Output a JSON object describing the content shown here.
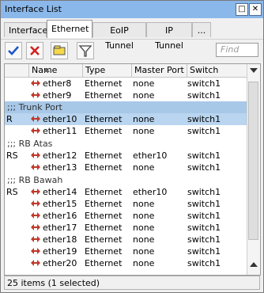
{
  "window": {
    "title": "Interface List",
    "restore_label": "□",
    "close_label": "✕"
  },
  "tabs": [
    {
      "label": "Interface"
    },
    {
      "label": "Ethernet"
    },
    {
      "label": "EoIP Tunnel"
    },
    {
      "label": "IP Tunnel"
    },
    {
      "label": "..."
    }
  ],
  "active_tab": "Ethernet",
  "toolbar": {
    "find_placeholder": "Find"
  },
  "table": {
    "columns": [
      "Name",
      "Type",
      "Master Port",
      "Switch"
    ],
    "rows": [
      {
        "flag": "",
        "name": "ether8",
        "type": "Ethernet",
        "master": "none",
        "switch": "switch1"
      },
      {
        "flag": "",
        "name": "ether9",
        "type": "Ethernet",
        "master": "none",
        "switch": "switch1"
      },
      {
        "group": ";;; Trunk Port"
      },
      {
        "flag": "R",
        "name": "ether10",
        "type": "Ethernet",
        "master": "none",
        "switch": "switch1",
        "selected": true
      },
      {
        "flag": "",
        "name": "ether11",
        "type": "Ethernet",
        "master": "none",
        "switch": "switch1"
      },
      {
        "group": ";;; RB Atas"
      },
      {
        "flag": "RS",
        "name": "ether12",
        "type": "Ethernet",
        "master": "ether10",
        "switch": "switch1"
      },
      {
        "flag": "",
        "name": "ether13",
        "type": "Ethernet",
        "master": "none",
        "switch": "switch1"
      },
      {
        "group": ";;; RB Bawah"
      },
      {
        "flag": "RS",
        "name": "ether14",
        "type": "Ethernet",
        "master": "ether10",
        "switch": "switch1"
      },
      {
        "flag": "",
        "name": "ether15",
        "type": "Ethernet",
        "master": "none",
        "switch": "switch1"
      },
      {
        "flag": "",
        "name": "ether16",
        "type": "Ethernet",
        "master": "none",
        "switch": "switch1"
      },
      {
        "flag": "",
        "name": "ether17",
        "type": "Ethernet",
        "master": "none",
        "switch": "switch1"
      },
      {
        "flag": "",
        "name": "ether18",
        "type": "Ethernet",
        "master": "none",
        "switch": "switch1"
      },
      {
        "flag": "",
        "name": "ether19",
        "type": "Ethernet",
        "master": "none",
        "switch": "switch1"
      },
      {
        "flag": "",
        "name": "ether20",
        "type": "Ethernet",
        "master": "none",
        "switch": "switch1"
      }
    ]
  },
  "status": {
    "text": "25 items (1 selected)"
  },
  "colors": {
    "titlebar": "#8bb8ea",
    "selected_row": "#b9d5ef",
    "enable_icon": "#1f56c8",
    "disable_icon": "#d42020",
    "eth_icon": "#c0392b"
  }
}
